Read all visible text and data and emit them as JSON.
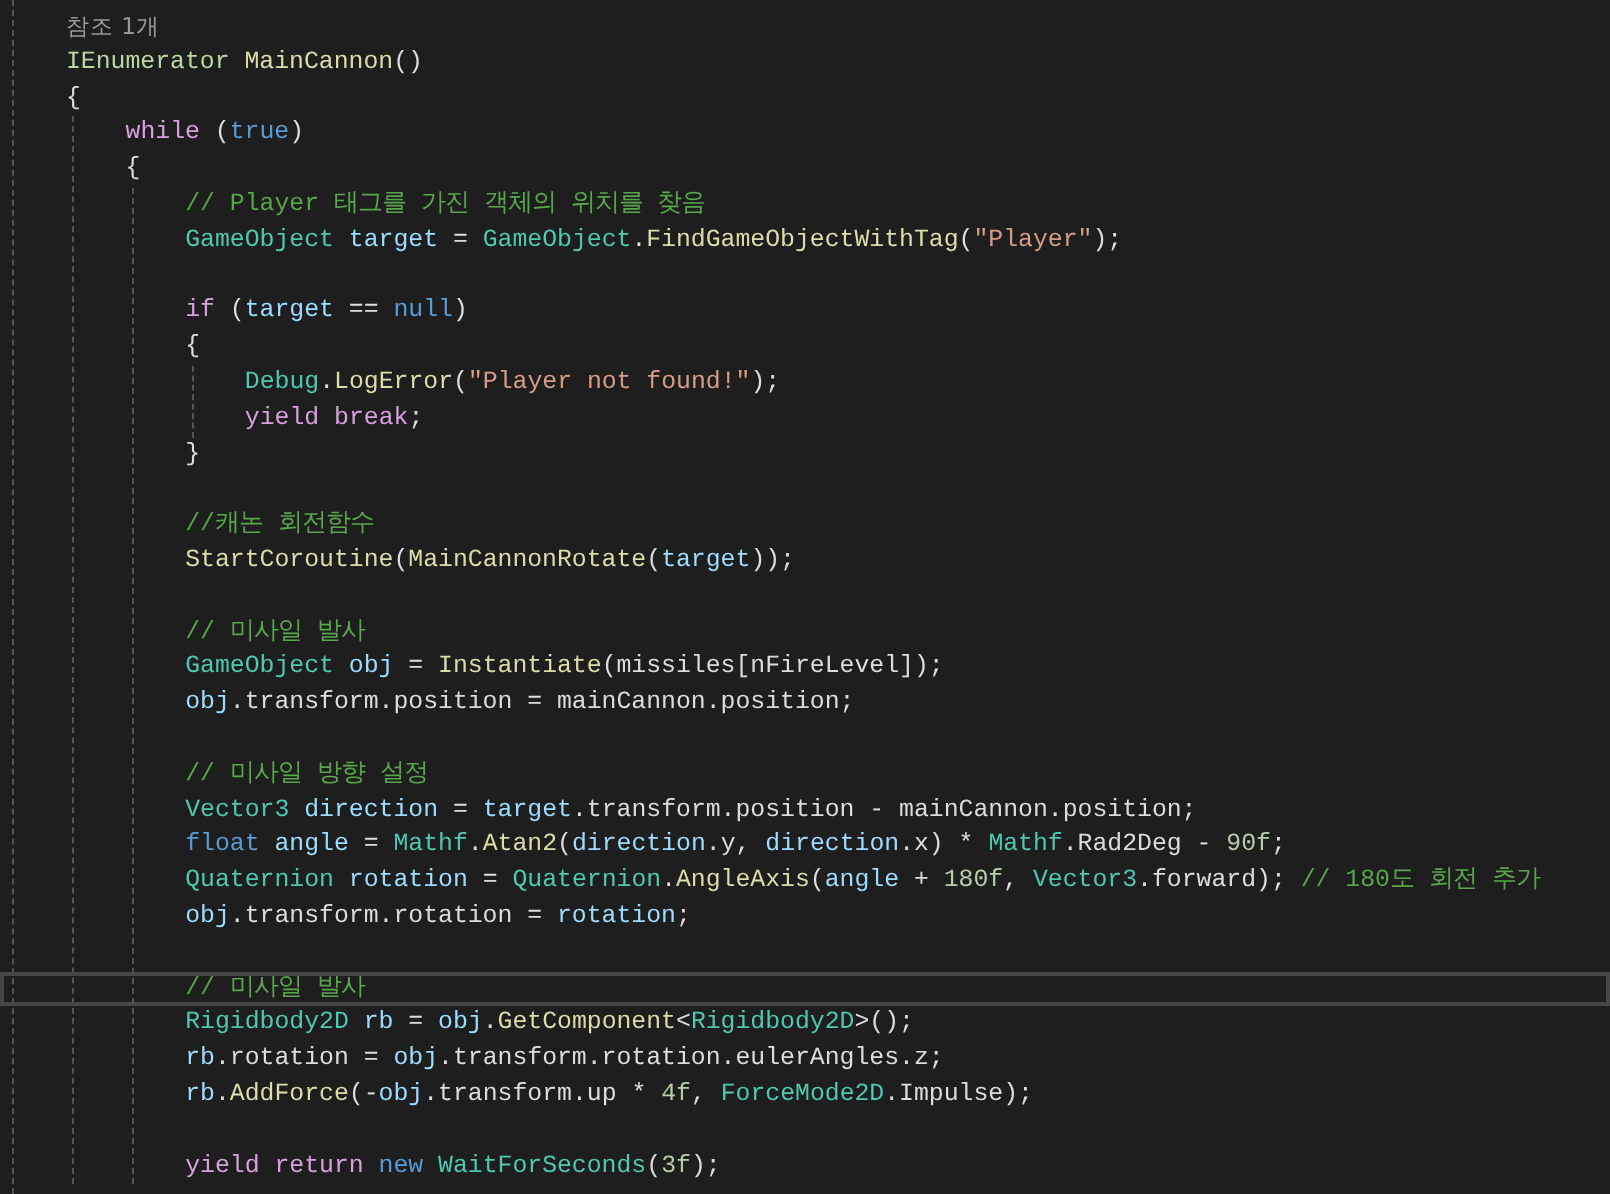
{
  "editor": {
    "codelens": "참조 1개",
    "lines": [
      {
        "kind": "code",
        "current": false,
        "tokens": [
          {
            "kind": "iface",
            "text": "IEnumerator "
          },
          {
            "kind": "method",
            "text": "MainCannon"
          },
          {
            "kind": "plain",
            "text": "()"
          }
        ]
      },
      {
        "kind": "code",
        "current": false,
        "tokens": [
          {
            "kind": "plain",
            "text": "{"
          }
        ]
      },
      {
        "kind": "block",
        "children": [
          {
            "kind": "code",
            "current": false,
            "tokens": [
              {
                "kind": "ctrl",
                "text": "while"
              },
              {
                "kind": "plain",
                "text": " ("
              },
              {
                "kind": "kw",
                "text": "true"
              },
              {
                "kind": "plain",
                "text": ")"
              }
            ]
          },
          {
            "kind": "code",
            "current": false,
            "tokens": [
              {
                "kind": "plain",
                "text": "{"
              }
            ]
          },
          {
            "kind": "block",
            "children": [
              {
                "kind": "code",
                "current": false,
                "tokens": [
                  {
                    "kind": "comment",
                    "text": "// Player 태그를 가진 객체의 위치를 찾음"
                  }
                ]
              },
              {
                "kind": "code",
                "current": false,
                "tokens": [
                  {
                    "kind": "type",
                    "text": "GameObject "
                  },
                  {
                    "kind": "local",
                    "text": "target"
                  },
                  {
                    "kind": "plain",
                    "text": " = "
                  },
                  {
                    "kind": "type",
                    "text": "GameObject"
                  },
                  {
                    "kind": "plain",
                    "text": "."
                  },
                  {
                    "kind": "method",
                    "text": "FindGameObjectWithTag"
                  },
                  {
                    "kind": "plain",
                    "text": "("
                  },
                  {
                    "kind": "str",
                    "text": "\"Player\""
                  },
                  {
                    "kind": "plain",
                    "text": ");"
                  }
                ]
              },
              {
                "kind": "blank"
              },
              {
                "kind": "code",
                "current": false,
                "tokens": [
                  {
                    "kind": "ctrl",
                    "text": "if"
                  },
                  {
                    "kind": "plain",
                    "text": " ("
                  },
                  {
                    "kind": "local",
                    "text": "target"
                  },
                  {
                    "kind": "plain",
                    "text": " == "
                  },
                  {
                    "kind": "kw",
                    "text": "null"
                  },
                  {
                    "kind": "plain",
                    "text": ")"
                  }
                ]
              },
              {
                "kind": "code",
                "current": false,
                "tokens": [
                  {
                    "kind": "plain",
                    "text": "{"
                  }
                ]
              },
              {
                "kind": "block",
                "children": [
                  {
                    "kind": "code",
                    "current": false,
                    "tokens": [
                      {
                        "kind": "type",
                        "text": "Debug"
                      },
                      {
                        "kind": "plain",
                        "text": "."
                      },
                      {
                        "kind": "method",
                        "text": "LogError"
                      },
                      {
                        "kind": "plain",
                        "text": "("
                      },
                      {
                        "kind": "str",
                        "text": "\"Player not found!\""
                      },
                      {
                        "kind": "plain",
                        "text": ");"
                      }
                    ]
                  },
                  {
                    "kind": "code",
                    "current": false,
                    "tokens": [
                      {
                        "kind": "ctrl",
                        "text": "yield "
                      },
                      {
                        "kind": "ctrl",
                        "text": "break"
                      },
                      {
                        "kind": "plain",
                        "text": ";"
                      }
                    ]
                  }
                ]
              },
              {
                "kind": "code",
                "current": false,
                "tokens": [
                  {
                    "kind": "plain",
                    "text": "}"
                  }
                ]
              },
              {
                "kind": "blank"
              },
              {
                "kind": "code",
                "current": false,
                "tokens": [
                  {
                    "kind": "comment",
                    "text": "//캐논 회전함수"
                  }
                ]
              },
              {
                "kind": "code",
                "current": false,
                "tokens": [
                  {
                    "kind": "method",
                    "text": "StartCoroutine"
                  },
                  {
                    "kind": "plain",
                    "text": "("
                  },
                  {
                    "kind": "method",
                    "text": "MainCannonRotate"
                  },
                  {
                    "kind": "plain",
                    "text": "("
                  },
                  {
                    "kind": "local",
                    "text": "target"
                  },
                  {
                    "kind": "plain",
                    "text": "));"
                  }
                ]
              },
              {
                "kind": "blank"
              },
              {
                "kind": "code",
                "current": false,
                "tokens": [
                  {
                    "kind": "comment",
                    "text": "// 미사일 발사"
                  }
                ]
              },
              {
                "kind": "code",
                "current": false,
                "tokens": [
                  {
                    "kind": "type",
                    "text": "GameObject "
                  },
                  {
                    "kind": "local",
                    "text": "obj"
                  },
                  {
                    "kind": "plain",
                    "text": " = "
                  },
                  {
                    "kind": "method",
                    "text": "Instantiate"
                  },
                  {
                    "kind": "plain",
                    "text": "(missiles[nFireLevel]);"
                  }
                ]
              },
              {
                "kind": "code",
                "current": false,
                "tokens": [
                  {
                    "kind": "local",
                    "text": "obj"
                  },
                  {
                    "kind": "plain",
                    "text": ".transform.position = mainCannon.position;"
                  }
                ]
              },
              {
                "kind": "blank"
              },
              {
                "kind": "code",
                "current": false,
                "tokens": [
                  {
                    "kind": "comment",
                    "text": "// 미사일 방향 설정"
                  }
                ]
              },
              {
                "kind": "code",
                "current": false,
                "tokens": [
                  {
                    "kind": "type",
                    "text": "Vector3 "
                  },
                  {
                    "kind": "local",
                    "text": "direction"
                  },
                  {
                    "kind": "plain",
                    "text": " = "
                  },
                  {
                    "kind": "local",
                    "text": "target"
                  },
                  {
                    "kind": "plain",
                    "text": ".transform.position - mainCannon.position;"
                  }
                ]
              },
              {
                "kind": "code",
                "current": false,
                "tokens": [
                  {
                    "kind": "kw",
                    "text": "float "
                  },
                  {
                    "kind": "local",
                    "text": "angle"
                  },
                  {
                    "kind": "plain",
                    "text": " = "
                  },
                  {
                    "kind": "type",
                    "text": "Mathf"
                  },
                  {
                    "kind": "plain",
                    "text": "."
                  },
                  {
                    "kind": "method",
                    "text": "Atan2"
                  },
                  {
                    "kind": "plain",
                    "text": "("
                  },
                  {
                    "kind": "local",
                    "text": "direction"
                  },
                  {
                    "kind": "plain",
                    "text": ".y, "
                  },
                  {
                    "kind": "local",
                    "text": "direction"
                  },
                  {
                    "kind": "plain",
                    "text": ".x) * "
                  },
                  {
                    "kind": "type",
                    "text": "Mathf"
                  },
                  {
                    "kind": "plain",
                    "text": ".Rad2Deg - "
                  },
                  {
                    "kind": "num",
                    "text": "90f"
                  },
                  {
                    "kind": "plain",
                    "text": ";"
                  }
                ]
              },
              {
                "kind": "code",
                "current": false,
                "tokens": [
                  {
                    "kind": "type",
                    "text": "Quaternion "
                  },
                  {
                    "kind": "local",
                    "text": "rotation"
                  },
                  {
                    "kind": "plain",
                    "text": " = "
                  },
                  {
                    "kind": "type",
                    "text": "Quaternion"
                  },
                  {
                    "kind": "plain",
                    "text": "."
                  },
                  {
                    "kind": "method",
                    "text": "AngleAxis"
                  },
                  {
                    "kind": "plain",
                    "text": "("
                  },
                  {
                    "kind": "local",
                    "text": "angle"
                  },
                  {
                    "kind": "plain",
                    "text": " + "
                  },
                  {
                    "kind": "num",
                    "text": "180f"
                  },
                  {
                    "kind": "plain",
                    "text": ", "
                  },
                  {
                    "kind": "type",
                    "text": "Vector3"
                  },
                  {
                    "kind": "plain",
                    "text": ".forward); "
                  },
                  {
                    "kind": "comment",
                    "text": "// 180도 회전 추가"
                  }
                ]
              },
              {
                "kind": "code",
                "current": false,
                "tokens": [
                  {
                    "kind": "local",
                    "text": "obj"
                  },
                  {
                    "kind": "plain",
                    "text": ".transform.rotation = "
                  },
                  {
                    "kind": "local",
                    "text": "rotation"
                  },
                  {
                    "kind": "plain",
                    "text": ";"
                  }
                ]
              },
              {
                "kind": "blank"
              },
              {
                "kind": "code",
                "current": true,
                "tokens": [
                  {
                    "kind": "comment",
                    "text": "// 미사일 발사"
                  }
                ]
              },
              {
                "kind": "code",
                "current": false,
                "tokens": [
                  {
                    "kind": "type",
                    "text": "Rigidbody2D "
                  },
                  {
                    "kind": "local",
                    "text": "rb"
                  },
                  {
                    "kind": "plain",
                    "text": " = "
                  },
                  {
                    "kind": "local",
                    "text": "obj"
                  },
                  {
                    "kind": "plain",
                    "text": "."
                  },
                  {
                    "kind": "method",
                    "text": "GetComponent"
                  },
                  {
                    "kind": "plain",
                    "text": "<"
                  },
                  {
                    "kind": "type",
                    "text": "Rigidbody2D"
                  },
                  {
                    "kind": "plain",
                    "text": ">();"
                  }
                ]
              },
              {
                "kind": "code",
                "current": false,
                "tokens": [
                  {
                    "kind": "local",
                    "text": "rb"
                  },
                  {
                    "kind": "plain",
                    "text": ".rotation = "
                  },
                  {
                    "kind": "local",
                    "text": "obj"
                  },
                  {
                    "kind": "plain",
                    "text": ".transform.rotation.eulerAngles.z;"
                  }
                ]
              },
              {
                "kind": "code",
                "current": false,
                "tokens": [
                  {
                    "kind": "local",
                    "text": "rb"
                  },
                  {
                    "kind": "plain",
                    "text": "."
                  },
                  {
                    "kind": "method",
                    "text": "AddForce"
                  },
                  {
                    "kind": "plain",
                    "text": "(-"
                  },
                  {
                    "kind": "local",
                    "text": "obj"
                  },
                  {
                    "kind": "plain",
                    "text": ".transform.up * "
                  },
                  {
                    "kind": "num",
                    "text": "4f"
                  },
                  {
                    "kind": "plain",
                    "text": ", "
                  },
                  {
                    "kind": "type",
                    "text": "ForceMode2D"
                  },
                  {
                    "kind": "plain",
                    "text": ".Impulse);"
                  }
                ]
              },
              {
                "kind": "blank"
              },
              {
                "kind": "code",
                "current": false,
                "tokens": [
                  {
                    "kind": "ctrl",
                    "text": "yield return "
                  },
                  {
                    "kind": "kw",
                    "text": "new "
                  },
                  {
                    "kind": "type",
                    "text": "WaitForSeconds"
                  },
                  {
                    "kind": "plain",
                    "text": "("
                  },
                  {
                    "kind": "num",
                    "text": "3f"
                  },
                  {
                    "kind": "plain",
                    "text": ");"
                  }
                ]
              }
            ]
          }
        ]
      }
    ]
  }
}
